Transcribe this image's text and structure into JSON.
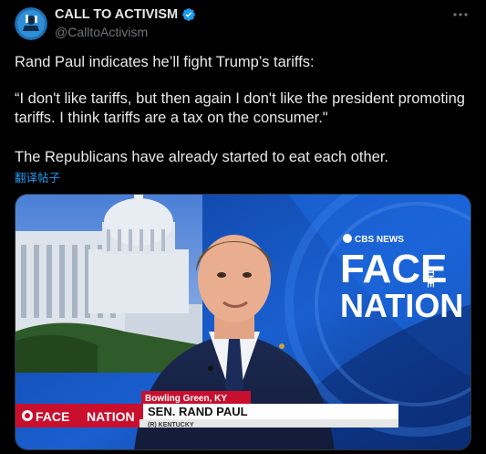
{
  "account": {
    "display_name": "CALL TO ACTIVISM",
    "handle": "@CalltoActivism",
    "verified": true,
    "verified_color": "#1d9bf0"
  },
  "tweet": {
    "line1": "Rand Paul indicates he’ll fight Trump’s tariffs:",
    "line2": "“I don't like tariffs, but then again I don't like the president promoting tariffs. I think tariffs are a tax on the consumer.\"",
    "line3": "The Republicans have already started to eat each other.",
    "translate_label": "翻译帖子"
  },
  "media": {
    "network": "CBS NEWS",
    "show_big_1": "FACE",
    "show_big_the": "THE",
    "show_big_2": "NATION",
    "location": "Bowling Green, KY",
    "lower_logo_face": "FACE",
    "lower_logo_nation": "NATION",
    "guest_name": "SEN. RAND PAUL",
    "guest_sub": "(R) KENTUCKY"
  },
  "colors": {
    "background": "#000000",
    "text_primary": "#e7e9ea",
    "text_secondary": "#71767b",
    "link": "#1d9bf0",
    "cbs_red": "#c8102e"
  },
  "icons": {
    "more": "more-horizontal-icon",
    "verified": "verified-badge-icon"
  }
}
